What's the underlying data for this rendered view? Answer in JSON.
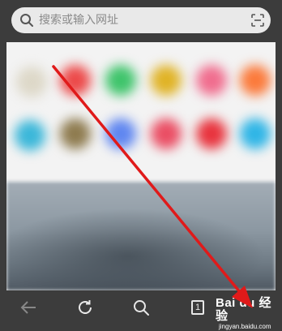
{
  "search": {
    "placeholder": "搜索或输入网址"
  },
  "tabs": {
    "count": "1"
  },
  "watermark": {
    "brand": "Bai du 经验",
    "url": "jingyan.baidu.com"
  },
  "icons": {
    "search": "search-icon",
    "scan": "scan-icon",
    "back": "back-arrow-icon",
    "refresh": "refresh-icon",
    "find": "search-icon",
    "tabs": "tabs-icon"
  },
  "colors": {
    "toolbar": "#3c3c3c",
    "search_box": "#e9e9e9",
    "annotation_arrow": "#e01a1a"
  }
}
